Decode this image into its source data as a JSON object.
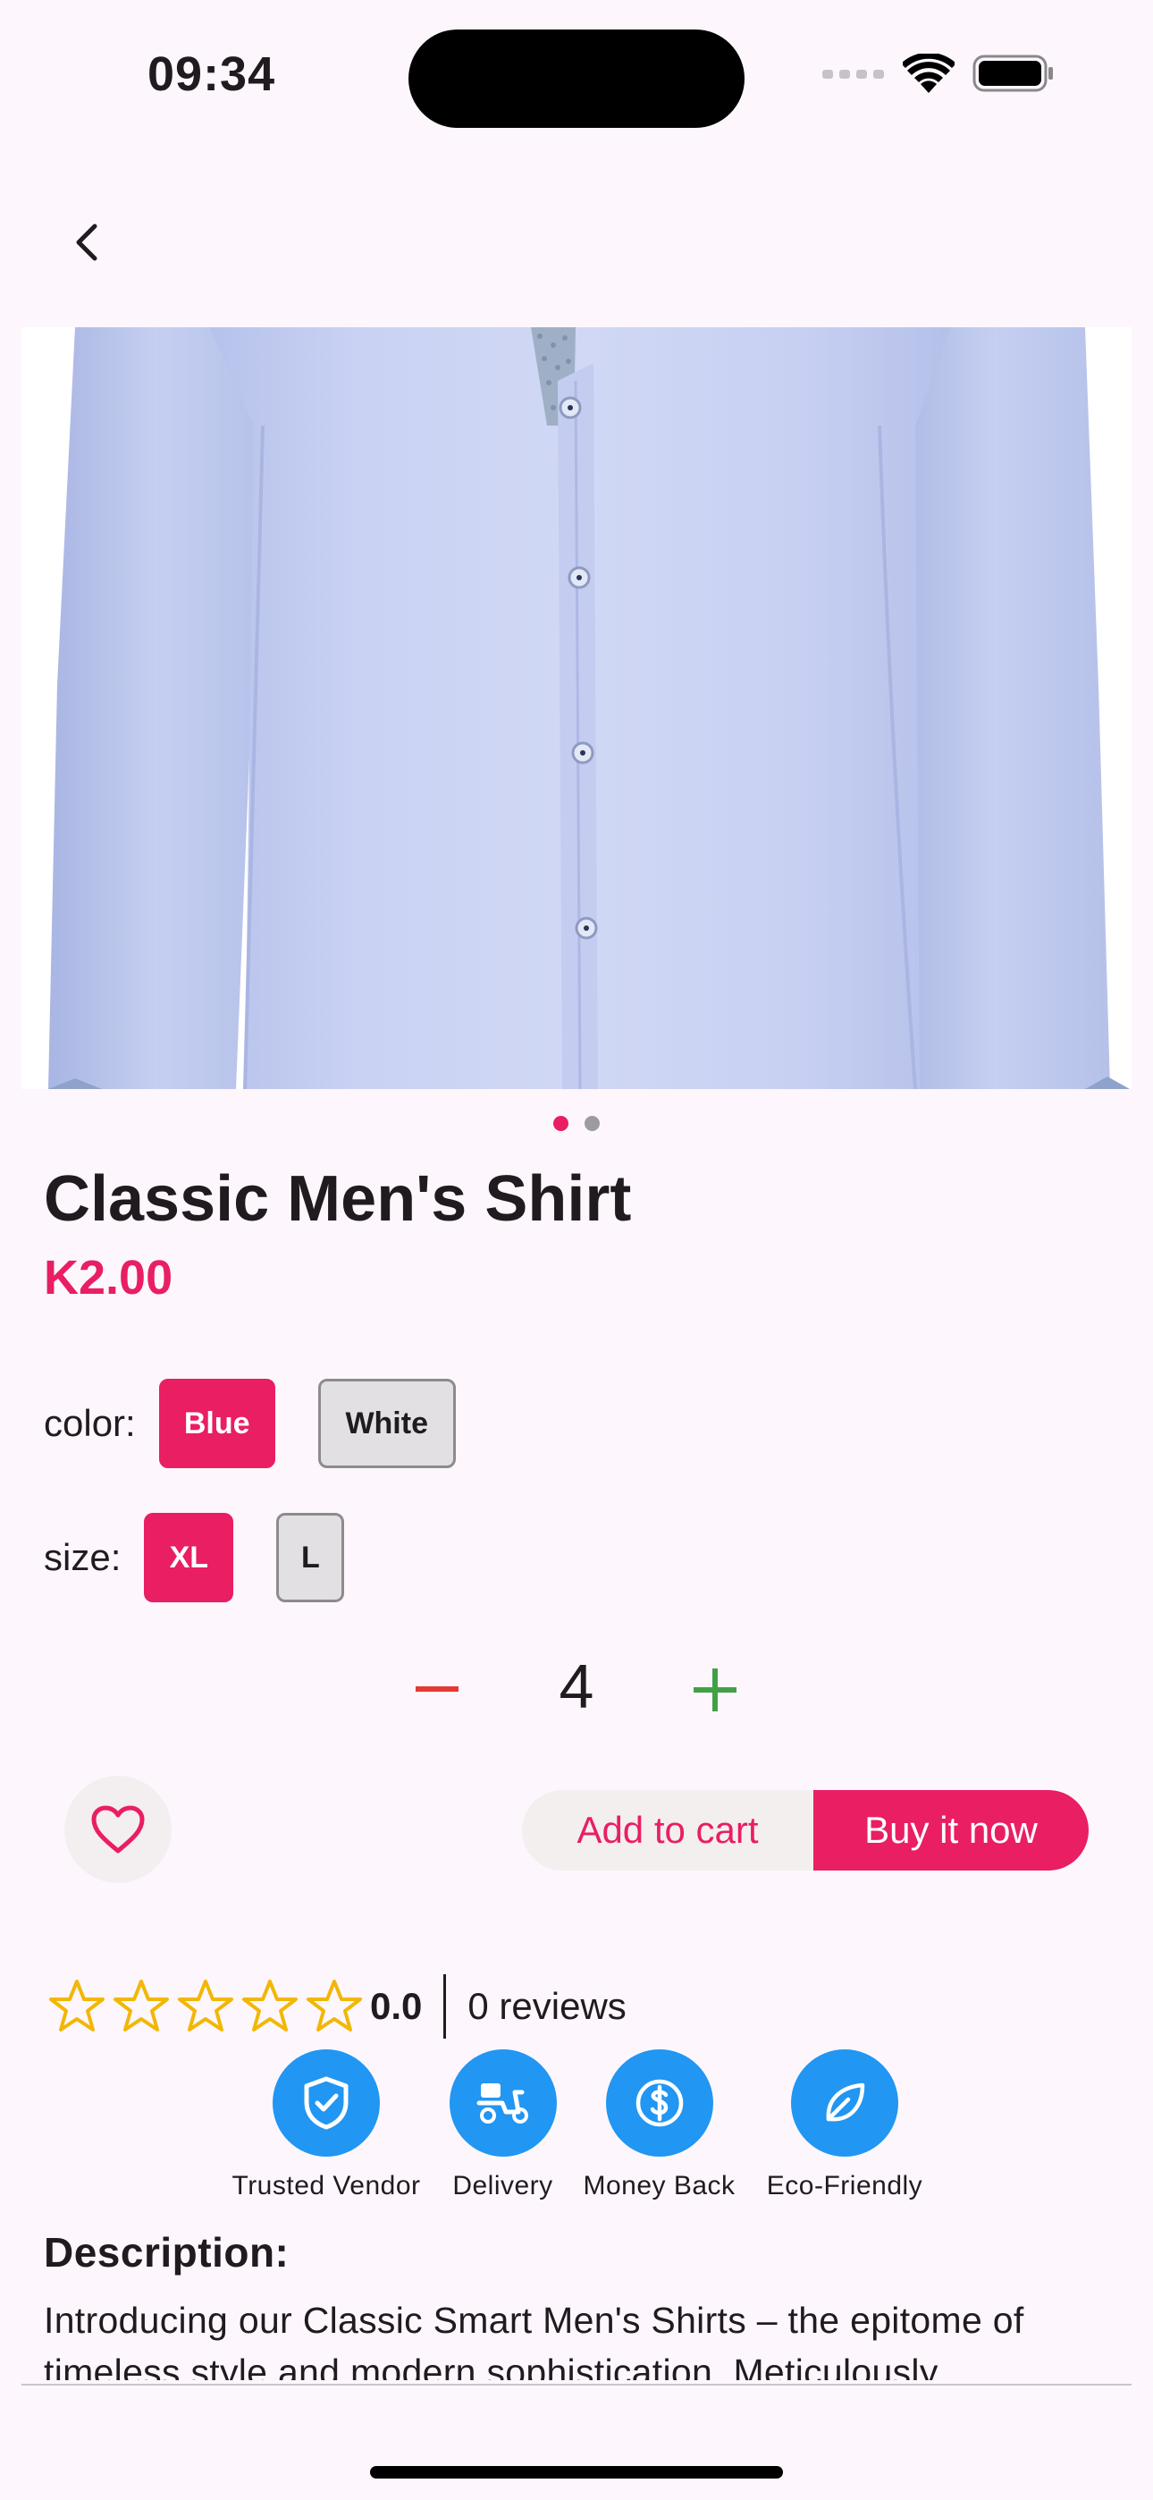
{
  "status_bar": {
    "time": "09:34"
  },
  "navigation": {
    "back_icon": "chevron-left-icon"
  },
  "product": {
    "image": "light-blue-dress-shirt",
    "image_pages": 2,
    "image_page_active": 1,
    "title": "Classic Men's Shirt",
    "price": "K2.00"
  },
  "options": {
    "color": {
      "label": "color:",
      "values": [
        "Blue",
        "White"
      ],
      "selected": "Blue"
    },
    "size": {
      "label": "size:",
      "values": [
        "XL",
        "L"
      ],
      "selected": "XL"
    }
  },
  "quantity": {
    "value": "4",
    "minus_icon": "minus-icon",
    "plus_icon": "plus-icon"
  },
  "actions": {
    "favorite_icon": "heart-icon",
    "add_to_cart": "Add to cart",
    "buy_now": "Buy it now"
  },
  "rating": {
    "stars_filled": 0,
    "stars_total": 5,
    "value": "0.0",
    "reviews": "0 reviews"
  },
  "features": [
    {
      "label": "Trusted Vendor",
      "icon": "shield-check-icon"
    },
    {
      "label": "Delivery",
      "icon": "scooter-icon"
    },
    {
      "label": "Money Back",
      "icon": "dollar-circle-icon"
    },
    {
      "label": "Eco-Friendly",
      "icon": "leaf-icon"
    }
  ],
  "description": {
    "heading": "Description:",
    "text": "Introducing our Classic Smart Men's Shirts – the epitome of timeless style and modern sophistication. Meticulously"
  },
  "colors": {
    "background": "#fdf7fd",
    "accent": "#e91e63",
    "feature_blue": "#2196f3",
    "star": "#f2b705",
    "minus": "#e53935",
    "plus": "#43a047"
  }
}
